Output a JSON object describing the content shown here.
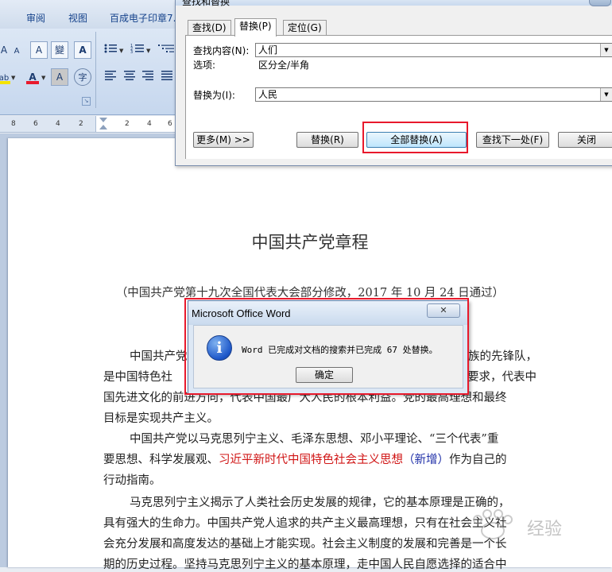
{
  "menubar": {
    "items": [
      "审阅",
      "视图",
      "百成电子印章7."
    ]
  },
  "ribbon": {
    "font_glyph_a": "A",
    "text_highlight_glyph": "ab",
    "font_color_glyph": "A",
    "char_shading_glyph": "A",
    "enclose_char_glyph": "字",
    "phonetic_glyph": "變",
    "char_border_glyph": "A",
    "clear_format_glyph": "A",
    "accent_highlight": "#f4e300",
    "accent_font_color": "#e8192c"
  },
  "ruler": {
    "ticks": [
      "8",
      "6",
      "4",
      "2",
      "2",
      "4",
      "6"
    ]
  },
  "find_replace": {
    "title": "查找和替换",
    "tabs": [
      "查找(D)",
      "替换(P)",
      "定位(G)"
    ],
    "find_label": "查找内容(N):",
    "find_value": "人们",
    "options_label": "选项:",
    "options_value": "区分全/半角",
    "replace_label": "替换为(I):",
    "replace_value": "人民",
    "buttons": {
      "more": "更多(M) >>",
      "replace": "替换(R)",
      "replace_all": "全部替换(A)",
      "find_next": "查找下一处(F)",
      "close": "关闭"
    }
  },
  "message_box": {
    "title": "Microsoft Office Word",
    "close_glyph": "✕",
    "icon_glyph": "i",
    "text": "Word 已完成对文档的搜索并已完成 67 处替换。",
    "ok": "确定"
  },
  "document": {
    "title": "中国共产党章程",
    "subtitle": "（中国共产党第十九次全国代表大会部分修改，2017 年 10 月 24 日通过）",
    "p1_start": "中国共产党",
    "p1_right": "华民族的先锋队，",
    "p2_left": "是中国特色社",
    "p2_right": "要求，代表中",
    "p3_a": "国先进文化的前进方向，代表中国",
    "p3_b": "最广大人民的根本利益。党的最高理想和最终",
    "p4": "目标是实现共产主义。",
    "p5": "中国共产党以马克思列宁主义、毛泽东思想、邓小平理论、“三个代表”重",
    "p6_a": "要思想、科学发展观、",
    "p6_red": "习近平新时代中国特色社会主义思想",
    "p6_blue": "（新增）",
    "p6_b": "作为自己的",
    "p7": "行动指南。",
    "p8": "马克思列宁主义揭示了人类社会历史发展的规律，它的基本原理是正确的，",
    "p9": "具有强大的生命力。中国共产党人追求的共产主义最高理想，只有在社会主义社",
    "p10": "会充分发展和高度发达的基础上才能实现。社会主义制度的发展和完善是一个长",
    "p11": "期的历史过程。坚持马克思列宁主义的基本原理，走中国人民自愿选择的适合中"
  },
  "watermark": {
    "text": "经验"
  }
}
